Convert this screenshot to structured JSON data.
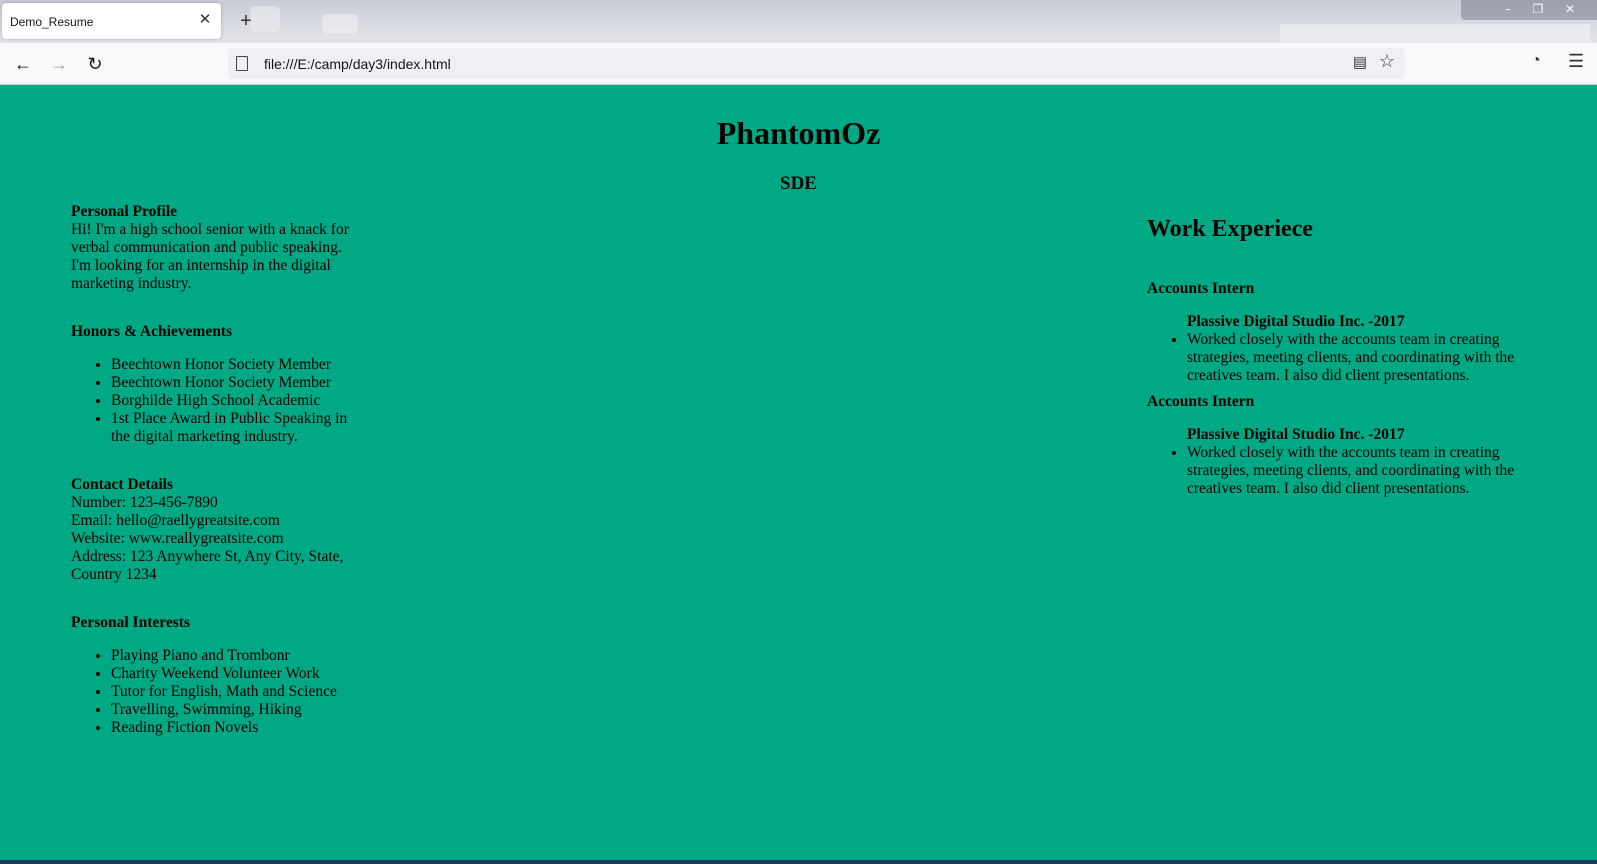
{
  "browser": {
    "tab_title": "Demo_Resume",
    "tab_close": "✕",
    "new_tab": "+",
    "url": "file:///E:/camp/day3/index.html",
    "back": "←",
    "forward": "→",
    "reload": "↻",
    "reader": "▤",
    "bookmark": "☆",
    "pocket": "◔",
    "menu": "☰",
    "win_minimize": "–",
    "win_restore": "❐",
    "win_close": "✕"
  },
  "resume": {
    "name": "PhantomOz",
    "role": "SDE",
    "profile": {
      "heading": "Personal Profile",
      "text": "Hi! I'm a high school senior with a knack for verbal communication and public speaking. I'm looking for an internship in the digital marketing industry."
    },
    "honors": {
      "heading": "Honors & Achievements",
      "items": [
        "Beechtown Honor Society Member",
        "Beechtown Honor Society Member",
        "Borghilde High School Academic",
        "1st Place Award in Public Speaking in the digital marketing industry."
      ]
    },
    "contact": {
      "heading": "Contact Details",
      "number": "Number: 123-456-7890",
      "email": "Email: hello@raellygreatsite.com",
      "website": "Website: www.reallygreatsite.com",
      "address": "Address: 123 Anywhere St, Any City, State, Country 1234"
    },
    "interests": {
      "heading": "Personal Interests",
      "items": [
        "Playing Piano and Trombonr",
        "Charity Weekend Volunteer Work",
        "Tutor for English, Math and Science",
        "Travelling, Swimming, Hiking",
        "Reading Fiction Novels"
      ]
    },
    "work": {
      "heading": "Work Experiece",
      "jobs": [
        {
          "title": "Accounts Intern",
          "company": "Plassive Digital Studio Inc. -2017",
          "description": "Worked closely with the accounts team in creating strategies, meeting clients, and coordinating with the creatives team. I also did client presentations."
        },
        {
          "title": "Accounts Intern",
          "company": "Plassive Digital Studio Inc. -2017",
          "description": "Worked closely with the accounts team in creating strategies, meeting clients, and coordinating with the creatives team. I also did client presentations."
        }
      ]
    }
  },
  "colors": {
    "page_background": "#00a884"
  }
}
